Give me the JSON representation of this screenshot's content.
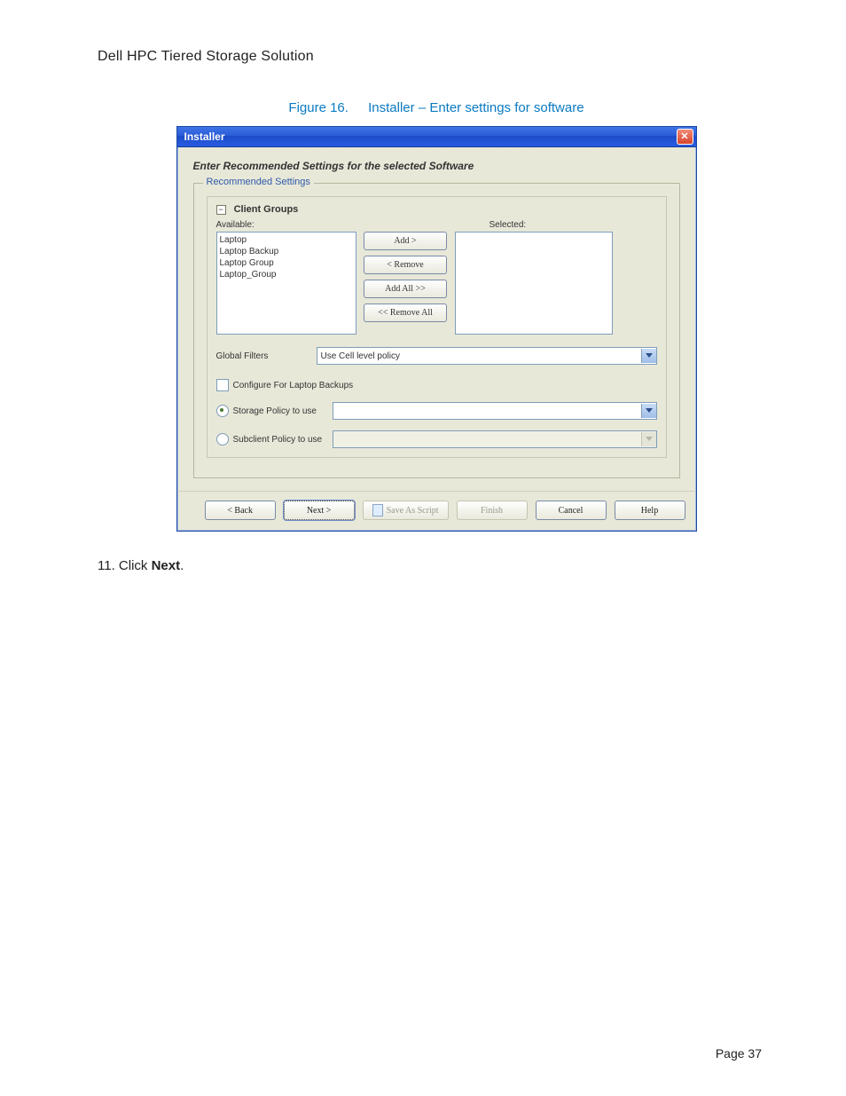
{
  "doc_title": "Dell HPC Tiered Storage Solution",
  "figure": {
    "number": "Figure 16.",
    "title": "Installer – Enter settings for software"
  },
  "window": {
    "title": "Installer",
    "heading": "Enter Recommended Settings for the selected Software",
    "fieldset_legend": "Recommended Settings",
    "client_groups": {
      "section_title": "Client Groups",
      "available_label": "Available:",
      "selected_label": "Selected:",
      "available_items": [
        "Laptop",
        "Laptop Backup",
        "Laptop Group",
        "Laptop_Group"
      ],
      "buttons": {
        "add": "Add >",
        "remove": "< Remove",
        "add_all": "Add All >>",
        "remove_all": "<< Remove All"
      }
    },
    "global_filters": {
      "label": "Global Filters",
      "value": "Use Cell level policy"
    },
    "configure_laptop": {
      "label": "Configure For Laptop Backups",
      "checked": false
    },
    "storage_policy": {
      "label": "Storage Policy to use",
      "selected": true,
      "value": ""
    },
    "subclient_policy": {
      "label": "Subclient Policy to use",
      "selected": false,
      "value": ""
    },
    "footer": {
      "back": "< Back",
      "next": "Next >",
      "save_script": "Save As Script",
      "finish": "Finish",
      "cancel": "Cancel",
      "help": "Help"
    }
  },
  "instruction": {
    "num": "11.",
    "pre": "Click ",
    "bold": "Next",
    "post": "."
  },
  "page_number": "Page 37"
}
